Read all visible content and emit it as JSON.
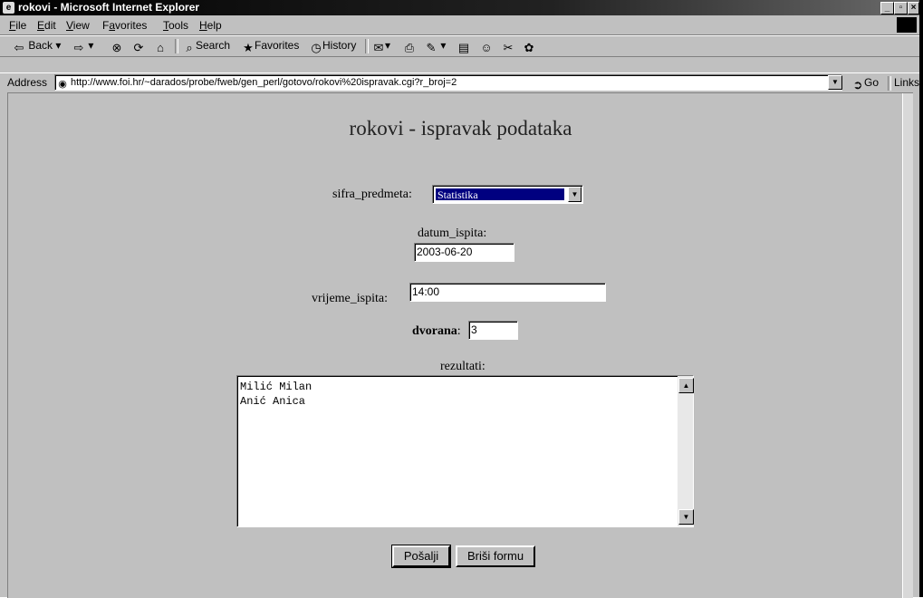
{
  "window": {
    "title": "rokovi - Microsoft Internet Explorer",
    "controls": [
      "_",
      "▫",
      "x"
    ]
  },
  "menu": [
    {
      "label": "File",
      "accel": "F",
      "rest": "ile"
    },
    {
      "label": "Edit",
      "accel": "E",
      "rest": "dit"
    },
    {
      "label": "View",
      "accel": "V",
      "rest": "iew"
    },
    {
      "label": "Favorites",
      "accel": "a",
      "pre": "F",
      "rest": "vorites"
    },
    {
      "label": "Tools",
      "accel": "T",
      "rest": "ools"
    },
    {
      "label": "Help",
      "accel": "H",
      "rest": "elp"
    }
  ],
  "toolbar": {
    "back": "Back",
    "search": "Search",
    "favorites": "Favorites",
    "history": "History"
  },
  "address": {
    "label": "Address",
    "url": "http://www.foi.hr/~darados/probe/fweb/gen_perl/gotovo/rokovi%20ispravak.cgi?r_broj=2",
    "go": "Go",
    "links": "Links"
  },
  "page": {
    "heading": "rokovi - ispravak podataka",
    "sifra_label": "sifra_predmeta:",
    "sifra_value": "Statistika",
    "datum_label": "datum_ispita:",
    "datum_value": "2003-06-20",
    "vrijeme_label": "vrijeme_ispita:",
    "vrijeme_value": "14:00",
    "dvorana_label": "dvorana",
    "dvorana_colon": ":",
    "dvorana_value": "3",
    "rezultati_label": "rezultati:",
    "rezultati_value": "Milić Milan\nAnić Anica",
    "submit_label": "Pošalji",
    "reset_label": "Briši formu"
  }
}
